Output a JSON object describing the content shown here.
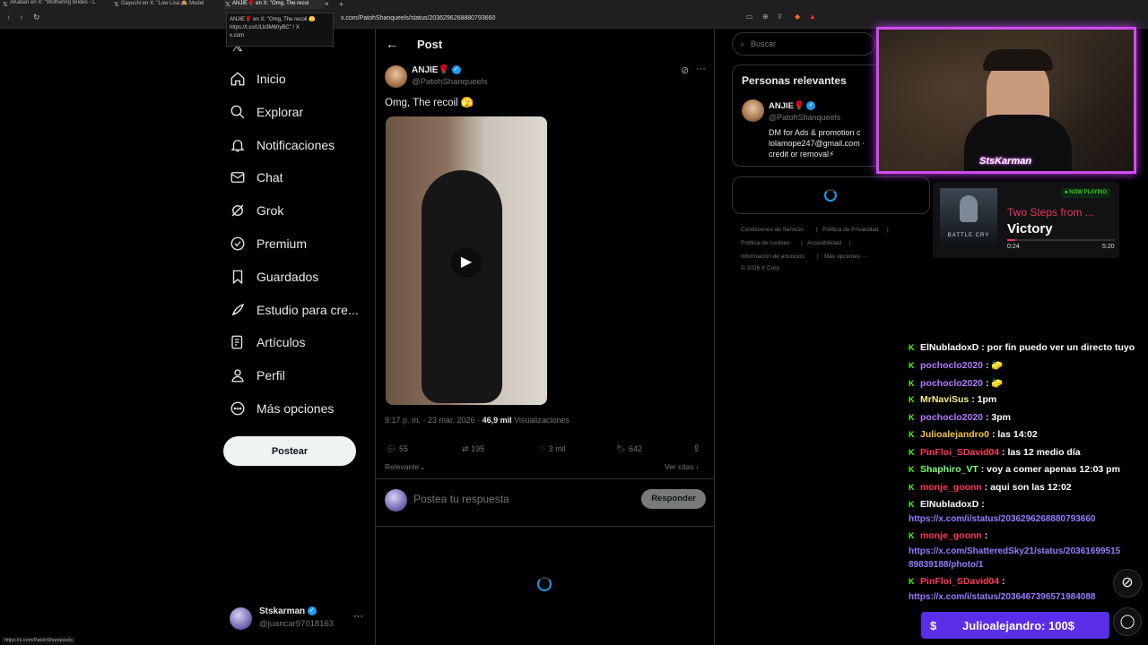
{
  "browser": {
    "tabs": [
      {
        "label": "AKaban en X: \"Wuthering Brides - L",
        "active": false
      },
      {
        "label": "Gayuchi en X: \"Low Lisa 🙈 Model",
        "active": false
      },
      {
        "label": "ANJIE🌹 en X: \"Omg, The recoi",
        "active": true
      }
    ],
    "new_tab": "+",
    "url": "x.com/PatohShanqueels/status/2036296268880793660",
    "tooltip_lines": [
      "ANJIE🌹 en X: \"Omg, The recoil 🫣",
      "https://t.co/ULb3M60yBC\" / X",
      "x.com"
    ],
    "status_url": "https://x.com/PatohShanqueels"
  },
  "nav": {
    "items": [
      {
        "label": "Inicio",
        "icon": "home-icon"
      },
      {
        "label": "Explorar",
        "icon": "search-icon"
      },
      {
        "label": "Notificaciones",
        "icon": "bell-icon"
      },
      {
        "label": "Chat",
        "icon": "mail-icon"
      },
      {
        "label": "Grok",
        "icon": "grok-icon"
      },
      {
        "label": "Premium",
        "icon": "premium-icon"
      },
      {
        "label": "Guardados",
        "icon": "bookmark-icon"
      },
      {
        "label": "Estudio para cre...",
        "icon": "rocket-icon"
      },
      {
        "label": "Artículos",
        "icon": "article-icon"
      },
      {
        "label": "Perfil",
        "icon": "person-icon"
      },
      {
        "label": "Más opciones",
        "icon": "more-circle-icon"
      }
    ],
    "post_button": "Postear",
    "account": {
      "name": "Stskarman",
      "handle": "@juancar97018163",
      "more": "···"
    }
  },
  "post": {
    "header": "Post",
    "author_name": "ANJIE🌹",
    "author_handle": "@PatohShanqueels",
    "text": "Omg, The recoil 🫣",
    "meta_time": "9:17 p. m. · 23 mar. 2026 · ",
    "views_count": "46,9 mil",
    "views_label": " Visualizaciones",
    "stats": {
      "replies": "55",
      "reposts": "195",
      "likes": "3 mil",
      "bookmarks": "642"
    },
    "relevant_label": "Relevante",
    "see_quotes": "Ver citas",
    "reply_placeholder": "Postea tu respuesta",
    "reply_button": "Responder"
  },
  "right": {
    "search_placeholder": "Buscar",
    "relevant_title": "Personas relevantes",
    "relevant_name": "ANJIE🌹",
    "relevant_handle": "@PatohShanqueels",
    "relevant_bio": [
      "DM for Ads & promotion c",
      "lolamope247@gmail.com ·",
      "credit or removal⚡"
    ],
    "footer": [
      "Condiciones de Servicio",
      "|",
      "Política de Privacidad",
      "|",
      "Política de cookies",
      "|",
      "Accesibilidad",
      "|",
      "Información de anuncios",
      "|",
      "Más opciones ···",
      "© 2026 X Corp."
    ]
  },
  "webcam": {
    "overlay_name": "StsKarman"
  },
  "now_playing": {
    "badge": "● NOW PLAYING",
    "album_text": "BATTLE CRY",
    "track_line": "Two Steps from ...",
    "track_title": "Victory",
    "elapsed": "0:24",
    "duration": "5:20",
    "progress": 0.075
  },
  "chat": {
    "messages": [
      {
        "user": "ElNubladoxD",
        "color": "#ffffff",
        "text": ": por fin puedo ver un directo tuyo"
      },
      {
        "user": "pochoclo2020",
        "color": "#b57bff",
        "text": ": 🧽"
      },
      {
        "user": "pochoclo2020",
        "color": "#b57bff",
        "text": ": 🧽"
      },
      {
        "user": "MrNaviSus",
        "color": "#f5f08a",
        "text": ": 1pm"
      },
      {
        "user": "pochoclo2020",
        "color": "#b57bff",
        "text": ": 3pm"
      },
      {
        "user": "Julioalejandro0",
        "color": "#f5c542",
        "text": ": las 14:02"
      },
      {
        "user": "PinFloi_SDavid04",
        "color": "#ff3b5c",
        "text": ": las 12 medio día"
      },
      {
        "user": "Shaphiro_VT",
        "color": "#7dff7a",
        "text": ": voy a comer apenas 12:03 pm"
      },
      {
        "user": "monje_goonn",
        "color": "#ff3b5c",
        "text": ": aqui son las 12:02"
      },
      {
        "user": "ElNubladoxD",
        "color": "#ffffff",
        "text": ":"
      },
      {
        "user": "monje_goonn",
        "color": "#ff3b5c",
        "text": ":"
      },
      {
        "user": "PinFloi_SDavid04",
        "color": "#ff3b5c",
        "text": ":"
      }
    ],
    "links": [
      "https://x.com/i/status/2036296268880793660",
      "https://x.com/ShatteredSky21/status/20361699515",
      "89839188/photo/1",
      "https://x.com/i/status/2036467396571984088"
    ],
    "donation": {
      "symbol": "$",
      "text": "Julioalejandro: 100$"
    }
  }
}
